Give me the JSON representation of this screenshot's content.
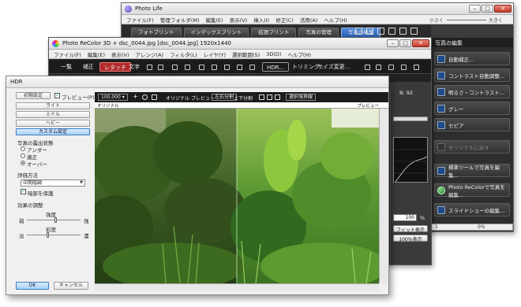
{
  "photo_life": {
    "title": "Photo Life",
    "menu": [
      "ファイル(F)",
      "管理フォルダ(M)",
      "編集(E)",
      "表示(V)",
      "挿入(I)",
      "修正(C)",
      "活用(A)",
      "ヘルプ(H)"
    ],
    "zoom_small": "小さく",
    "zoom_large": "大きく",
    "tabs": [
      "フォトプリント",
      "インデックスプリント",
      "拡張プリント",
      "写真の管理",
      "写真の編集"
    ],
    "active_tab": 4,
    "side_title": "写真の編集",
    "side_buttons": [
      "自動補正...",
      "コントラスト自動調整...",
      "明るさ・コントラスト...",
      "グレー",
      "セピア",
      "オリジナルに戻す",
      "標準ツールで写真を編集...",
      "Photo ReColorで写真を編集...",
      "スライドショーの編集..."
    ],
    "status_value": "1",
    "status_percent": "0%"
  },
  "recolor": {
    "title": "Photo ReColor 3D + dsc_0044.jpg [dsc_0044.jpg] 1920x1440",
    "menu": [
      "ファイル(F)",
      "編集(E)",
      "表示(V)",
      "アレンジ(A)",
      "フィルタ(L)",
      "レイヤ(Y)",
      "選択範囲(S)",
      "3D(D)",
      "ヘルプ(H)"
    ],
    "toolbar_buttons": [
      "一覧",
      "補正",
      "レタッチ",
      "文字"
    ],
    "hdr_button": "HDR...",
    "trim_label": "トリミング...",
    "resize_label": "サイズ変更...",
    "info_value": "B: 92",
    "zoom_value": "100",
    "unit": "%",
    "fit_button": "フィット表示",
    "actual_button": "100%表示"
  },
  "hdr": {
    "title": "HDR",
    "init_button": "初期設定",
    "preview_label": "プレビュー(P)",
    "presets": [
      "ライト",
      "ミドル",
      "ヘビー",
      "カスタム設定"
    ],
    "selected_preset": 3,
    "exposure_label": "写真の露出状態",
    "exposure_options": [
      "アンダー",
      "適正",
      "オーバー"
    ],
    "exposure_selected": 2,
    "eval_label": "評価方法",
    "eval_value": "中間階調",
    "protect_label": "暗部を保護",
    "effect_label": "効果の調整",
    "strength_label": "強度",
    "strength_min": "弱",
    "strength_max": "強",
    "strength_level": 0.55,
    "color_label": "彩度",
    "color_min": "淡",
    "color_max": "濃",
    "color_level": 0.4,
    "ok": "OK",
    "cancel": "キャンセル",
    "zoom": "100.000",
    "view_buttons": [
      "オリジナル",
      "プレビュー",
      "左右分割",
      "上下分割",
      "選択境界線"
    ],
    "label_original": "オリジナル",
    "label_preview": "プレビュー"
  }
}
